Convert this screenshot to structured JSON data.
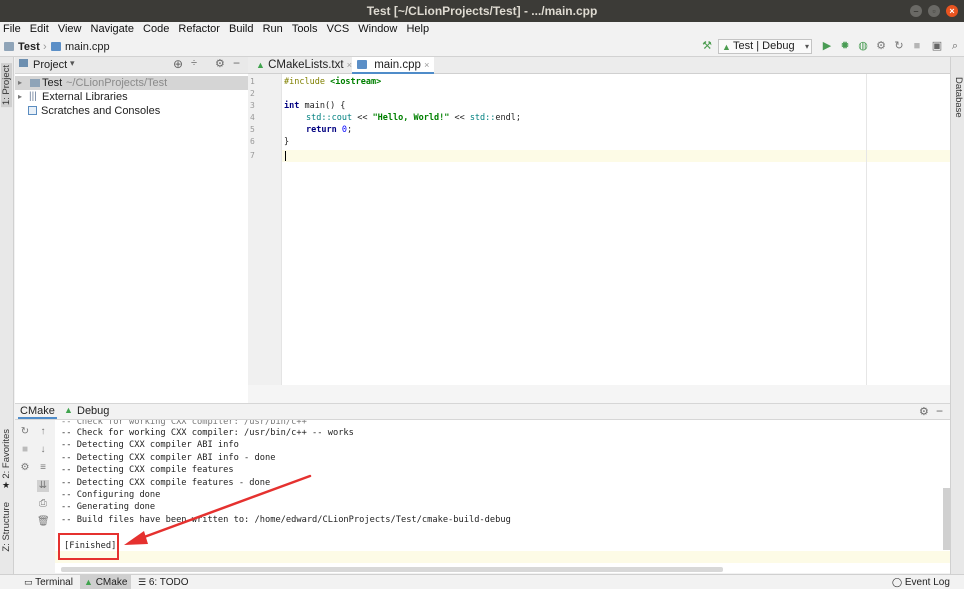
{
  "window": {
    "title": "Test [~/CLionProjects/Test] - .../main.cpp",
    "min": "–",
    "max": "▫",
    "close": "×"
  },
  "menu": [
    "File",
    "Edit",
    "View",
    "Navigate",
    "Code",
    "Refactor",
    "Build",
    "Run",
    "Tools",
    "VCS",
    "Window",
    "Help"
  ],
  "breadcrumb": {
    "project": "Test",
    "file": "main.cpp"
  },
  "run_config": "Test | Debug",
  "toolbar_icons": [
    "build-hammer-icon",
    "run-icon",
    "debug-icon",
    "coverage-icon",
    "profile-icon",
    "attach-icon",
    "stop-icon",
    "project-structure-icon",
    "search-everywhere-icon"
  ],
  "left_stripe": {
    "project": "1: Project",
    "favorites": "2: Favorites",
    "structure": "Z: Structure"
  },
  "right_stripe": {
    "database": "Database"
  },
  "project_panel": {
    "title": "Project",
    "tree": [
      {
        "label": "Test",
        "path": "~/CLionProjects/Test",
        "icon": "folder-icon"
      },
      {
        "label": "External Libraries",
        "icon": "library-icon"
      },
      {
        "label": "Scratches and Consoles",
        "icon": "scratches-icon"
      }
    ]
  },
  "editor": {
    "tabs": [
      {
        "label": "CMakeLists.txt",
        "icon": "cmake-icon",
        "active": false
      },
      {
        "label": "main.cpp",
        "icon": "cpp-file-icon",
        "active": true
      }
    ],
    "line_numbers": [
      "1",
      "2",
      "3",
      "4",
      "5",
      "6",
      "7"
    ],
    "code": {
      "l1_kw": "#include",
      "l1_hdr": "<iostream>",
      "l3_kw": "int",
      "l3_rest": " main() {",
      "l4_ns1": "std::",
      "l4_cout": "cout",
      "l4_op1": " << ",
      "l4_str": "\"Hello, World!\"",
      "l4_op2": " << ",
      "l4_ns2": "std::",
      "l4_endl": "endl;",
      "l5_kw": "return",
      "l5_num": "0",
      "l5_semi": ";",
      "l6": "}"
    }
  },
  "tool_window": {
    "tabs": [
      {
        "label": "CMake",
        "active": true
      },
      {
        "label": "Debug",
        "icon": "cmake-icon",
        "active": false
      }
    ],
    "output": [
      "-- Check for working CXX compiler: /usr/bin/c++ -- works",
      "-- Detecting CXX compiler ABI info",
      "-- Detecting CXX compiler ABI info - done",
      "-- Detecting CXX compile features",
      "-- Detecting CXX compile features - done",
      "-- Configuring done",
      "-- Generating done",
      "-- Build files have been written to: /home/edward/CLionProjects/Test/cmake-build-debug"
    ],
    "finished": "[Finished]"
  },
  "annotation": {
    "color": "#e5312f"
  },
  "statusbar": {
    "terminal": "Terminal",
    "cmake": "CMake",
    "todo": "6: TODO",
    "event_log": "Event Log"
  }
}
